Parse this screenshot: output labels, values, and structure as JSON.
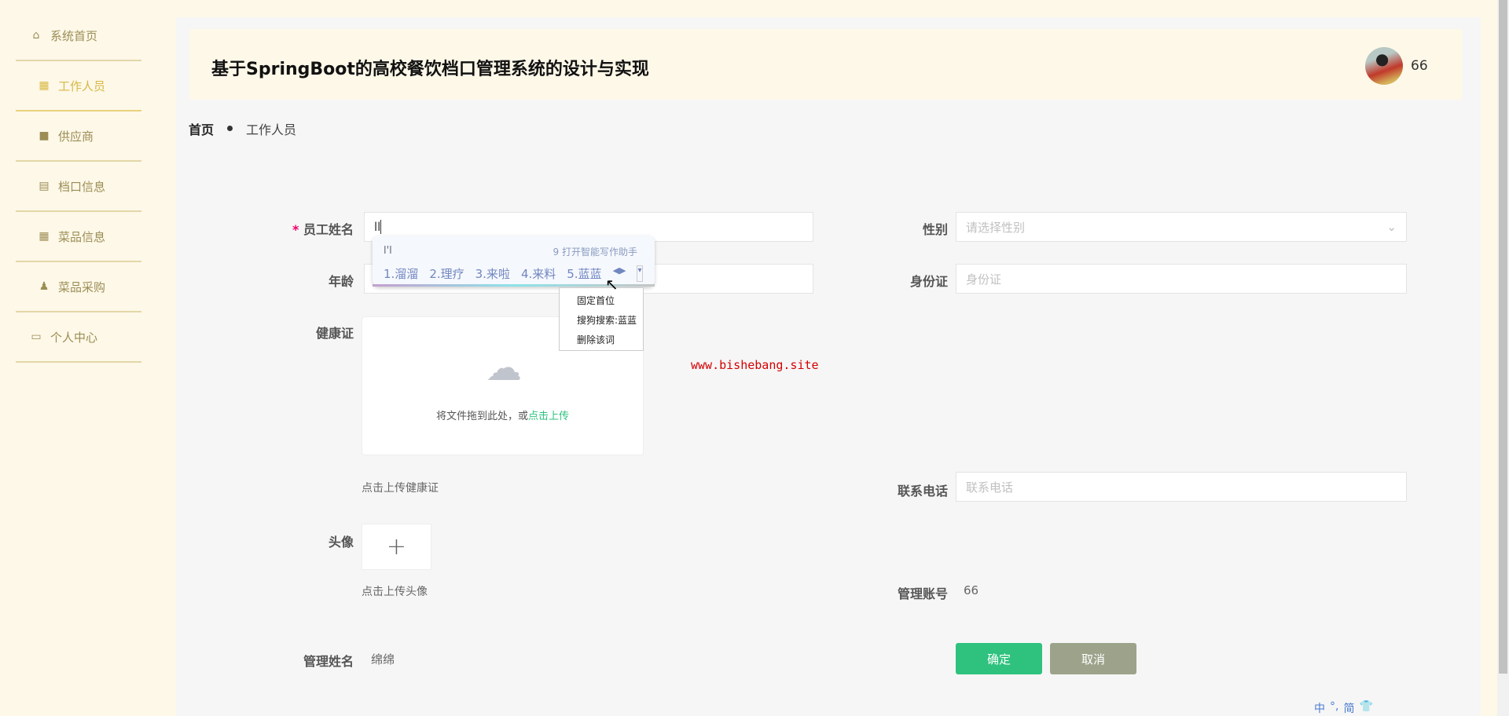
{
  "sidebar": {
    "items": [
      {
        "label": "系统首页",
        "icon": "home-icon"
      },
      {
        "label": "工作人员",
        "icon": "grid-icon",
        "active": true
      },
      {
        "label": "供应商",
        "icon": "briefcase-icon"
      },
      {
        "label": "档口信息",
        "icon": "clipboard-icon"
      },
      {
        "label": "菜品信息",
        "icon": "grid-icon"
      },
      {
        "label": "菜品采购",
        "icon": "user-icon"
      },
      {
        "label": "个人中心",
        "icon": "card-icon"
      }
    ]
  },
  "header": {
    "title": "基于SpringBoot的高校餐饮档口管理系统的设计与实现",
    "username": "66"
  },
  "breadcrumb": {
    "home": "首页",
    "current": "工作人员"
  },
  "form": {
    "name_label": "员工姓名",
    "name_value": "ll",
    "required_mark": "*",
    "gender_label": "性别",
    "gender_placeholder": "请选择性别",
    "age_label": "年龄",
    "id_label": "身份证",
    "id_placeholder": "身份证",
    "health_label": "健康证",
    "upload_text": "将文件拖到此处，或",
    "upload_link": "点击上传",
    "health_hint": "点击上传健康证",
    "phone_label": "联系电话",
    "phone_placeholder": "联系电话",
    "avatar_label": "头像",
    "avatar_hint": "点击上传头像",
    "account_label": "管理账号",
    "account_value": "66",
    "admin_name_label": "管理姓名",
    "admin_name_value": "绵绵",
    "confirm": "确定",
    "cancel": "取消"
  },
  "watermark": "www.bishebang.site",
  "ime": {
    "composition": "l'l",
    "assistant": "9 打开智能写作助手",
    "candidates": [
      "1.溜溜",
      "2.理疗",
      "3.来啦",
      "4.来料",
      "5.蓝蓝"
    ],
    "context_menu": [
      "固定首位",
      "搜狗搜索:蓝蓝",
      "删除该词"
    ],
    "status": [
      "中",
      "°,",
      "简",
      "👕"
    ]
  },
  "colors": {
    "accent": "#2ec27e",
    "cancel": "#9ca38a",
    "sidebar_active": "#d8b844"
  }
}
